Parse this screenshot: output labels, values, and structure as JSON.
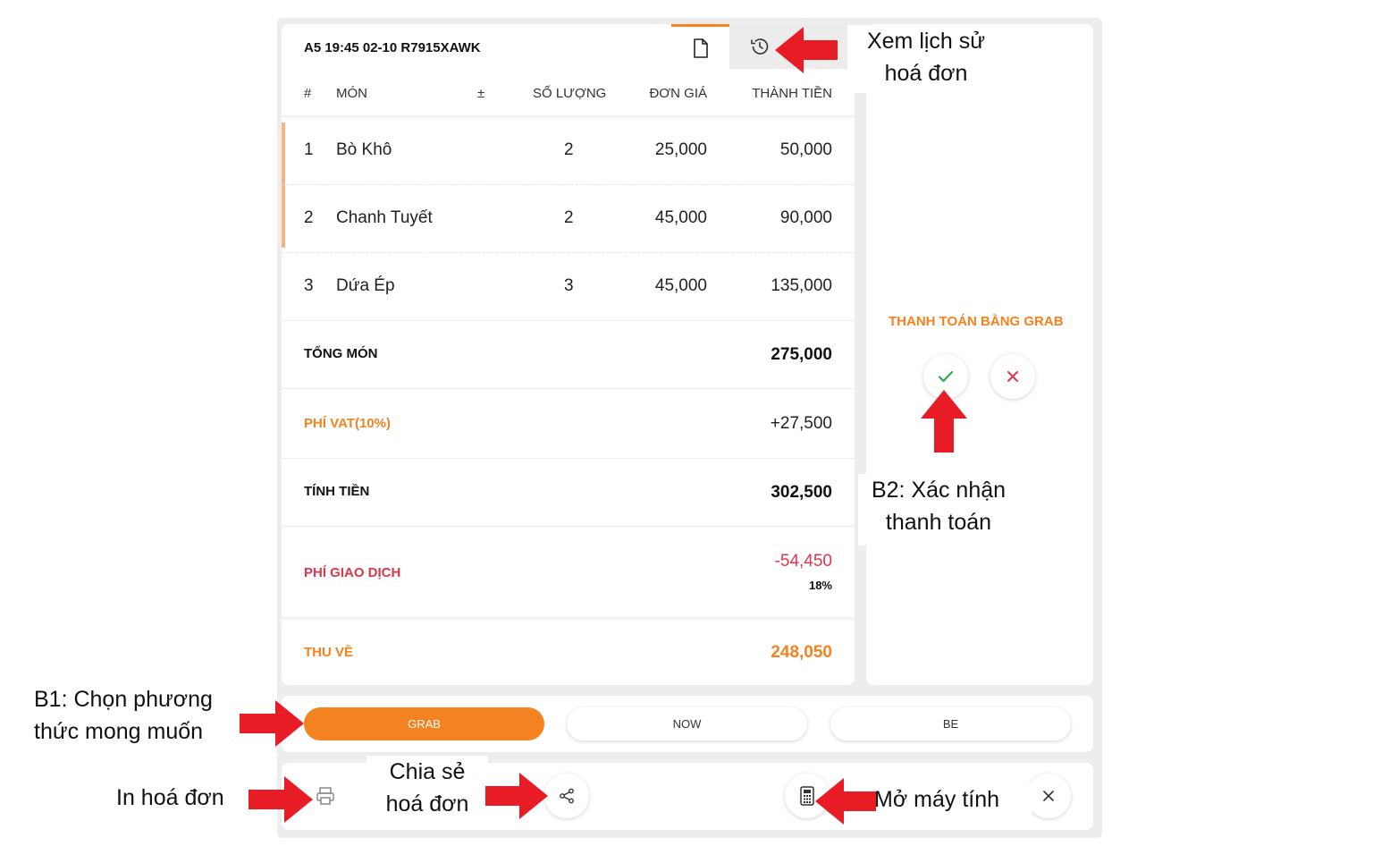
{
  "bill": {
    "order_code": "A5 19:45 02-10 R7915XAWK",
    "columns": {
      "index": "#",
      "item": "MÓN",
      "adjust": "±",
      "qty": "SỐ LƯỢNG",
      "price": "ĐƠN GIÁ",
      "total": "THÀNH TIỀN"
    },
    "rows": [
      {
        "index": "1",
        "item": "Bò Khô",
        "qty": "2",
        "price": "25,000",
        "total": "50,000"
      },
      {
        "index": "2",
        "item": "Chanh Tuyết",
        "qty": "2",
        "price": "45,000",
        "total": "90,000"
      },
      {
        "index": "3",
        "item": "Dứa Ép",
        "qty": "3",
        "price": "45,000",
        "total": "135,000"
      }
    ],
    "subtotal": {
      "label": "TỔNG MÓN",
      "value": "275,000"
    },
    "vat": {
      "label": "PHÍ VAT(10%)",
      "value": "+27,500"
    },
    "charge": {
      "label": "TÍNH TIỀN",
      "value": "302,500"
    },
    "fee": {
      "label": "PHÍ GIAO DỊCH",
      "value": "-54,450",
      "percent": "18%"
    },
    "receive": {
      "label": "THU VỀ",
      "value": "248,050"
    }
  },
  "side": {
    "title": "THANH TOÁN BẰNG GRAB"
  },
  "methods": [
    {
      "label": "GRAB",
      "selected": true
    },
    {
      "label": "NOW",
      "selected": false
    },
    {
      "label": "BE",
      "selected": false
    }
  ],
  "annotations": {
    "history_1": "Xem lịch sử",
    "history_2": "hoá đơn",
    "confirm_1": "B2: Xác nhận",
    "confirm_2": "thanh toán",
    "choose_1": "B1: Chọn phương",
    "choose_2": "thức mong muốn",
    "print": "In hoá đơn",
    "share_1": "Chia sẻ",
    "share_2": "hoá đơn",
    "calc": "Mở máy tính"
  },
  "colors": {
    "accent": "#f58220",
    "danger": "#e0354b",
    "success": "#2eaa4a",
    "arrow": "#e81c24"
  },
  "icons": [
    "document-icon",
    "history-icon",
    "check-icon",
    "close-icon",
    "printer-icon",
    "share-icon",
    "calculator-icon"
  ]
}
